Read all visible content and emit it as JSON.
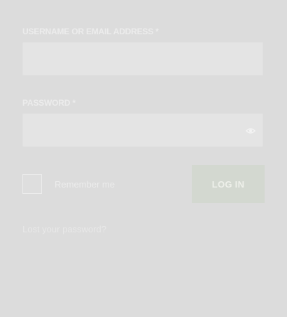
{
  "form": {
    "username_label": "USERNAME OR EMAIL ADDRESS",
    "required_marker": "*",
    "username_value": "",
    "password_label": "PASSWORD",
    "password_value": "",
    "remember_label": "Remember me",
    "remember_checked": false,
    "login_label": "LOG IN",
    "lost_password_label": "Lost your password?"
  },
  "icons": {
    "password_toggle": "eye-icon"
  },
  "colors": {
    "background": "#dcdcdc",
    "button": "#d3d8d0"
  }
}
